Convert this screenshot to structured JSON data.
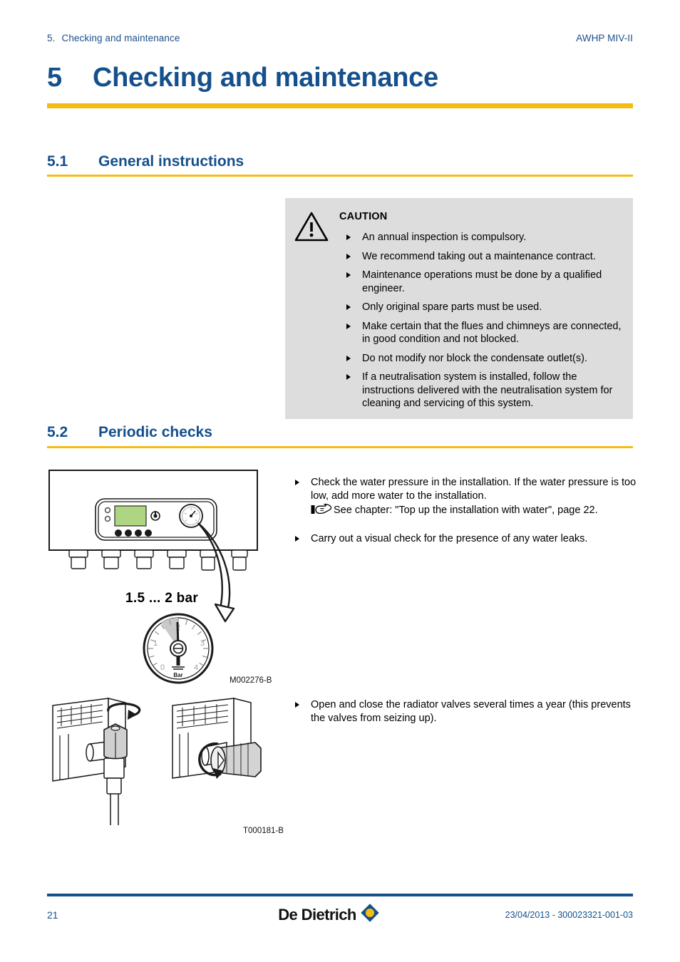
{
  "header": {
    "chapter_number": "5.",
    "chapter_running_title": "Checking and maintenance",
    "product": "AWHP MIV-II"
  },
  "title": {
    "number": "5",
    "text": "Checking and maintenance"
  },
  "sections": [
    {
      "number": "5.1",
      "title": "General instructions"
    },
    {
      "number": "5.2",
      "title": "Periodic checks"
    }
  ],
  "caution": {
    "icon": "warning-triangle-icon",
    "title": "CAUTION",
    "items": [
      "An annual inspection is compulsory.",
      "We recommend taking out a maintenance contract.",
      "Maintenance operations must be done by a qualified engineer.",
      "Only original spare parts must be used.",
      "Make certain that the flues and chimneys are connected, in good condition and not blocked.",
      "Do not modify nor block the condensate outlet(s).",
      "If a neutralisation system is installed, follow the instructions delivered with the neutralisation system for cleaning and servicing of this system."
    ]
  },
  "periodic_checks": {
    "items": [
      {
        "text": "Check the water pressure in the installation. If the water pressure is too low, add more water to the installation.",
        "xref_icon": "pointing-hand-icon",
        "xref": "See chapter: \"Top up the installation with water\", page 22."
      },
      {
        "text": "Carry out a visual check for the presence of any water leaks."
      },
      {
        "text": "Open and close the radiator valves several times a year (this prevents the valves from seizing up)."
      }
    ]
  },
  "figures": {
    "boiler": {
      "name": "boiler-pressure-gauge-figure",
      "caption": "M002276-B",
      "gauge_label": "1.5 ... 2 bar",
      "dial_unit": "Bar",
      "dial_ticks": [
        "0",
        "1",
        "2",
        "3",
        "4"
      ],
      "display_color": "#aed581"
    },
    "radiator": {
      "name": "radiator-valve-figure",
      "caption": "T000181-B"
    }
  },
  "footer": {
    "page_number": "21",
    "brand": "De Dietrich",
    "doc_reference": "23/04/2013 - 300023321-001-03"
  },
  "colors": {
    "brand_blue": "#15508c",
    "accent_yellow": "#f5bc10",
    "caution_bg": "#dddddd"
  }
}
